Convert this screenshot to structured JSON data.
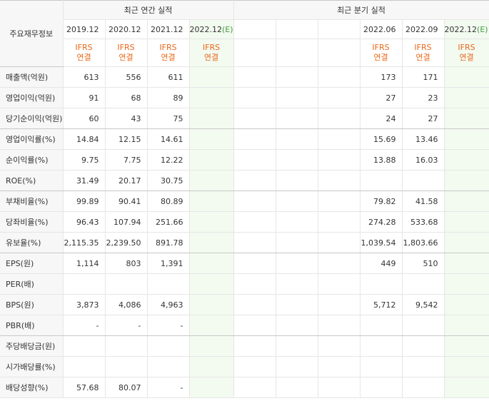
{
  "header": {
    "row_label": "주요재무정보",
    "annual_group": "최근 연간 실적",
    "quarter_group": "최근 분기 실적"
  },
  "annual_periods": [
    {
      "label": "2019.12",
      "estimate_mark": ""
    },
    {
      "label": "2020.12",
      "estimate_mark": ""
    },
    {
      "label": "2021.12",
      "estimate_mark": ""
    },
    {
      "label": "2022.12",
      "estimate_mark": "(E)"
    }
  ],
  "quarter_periods": [
    {
      "label": "",
      "estimate_mark": ""
    },
    {
      "label": "",
      "estimate_mark": ""
    },
    {
      "label": "",
      "estimate_mark": ""
    },
    {
      "label": "2022.06",
      "estimate_mark": ""
    },
    {
      "label": "2022.09",
      "estimate_mark": ""
    },
    {
      "label": "2022.12",
      "estimate_mark": "(E)"
    }
  ],
  "basis": {
    "line1": "IFRS",
    "line2": "연결"
  },
  "rows": [
    {
      "label": "매출액(억원)",
      "annual": [
        "613",
        "556",
        "611",
        ""
      ],
      "quarter": [
        "",
        "",
        "",
        "173",
        "171",
        ""
      ]
    },
    {
      "label": "영업이익(억원)",
      "annual": [
        "91",
        "68",
        "89",
        ""
      ],
      "quarter": [
        "",
        "",
        "",
        "27",
        "23",
        ""
      ]
    },
    {
      "label": "당기순이익(억원)",
      "annual": [
        "60",
        "43",
        "75",
        ""
      ],
      "quarter": [
        "",
        "",
        "",
        "24",
        "27",
        ""
      ]
    },
    {
      "label": "영업이익률(%)",
      "annual": [
        "14.84",
        "12.15",
        "14.61",
        ""
      ],
      "quarter": [
        "",
        "",
        "",
        "15.69",
        "13.46",
        ""
      ]
    },
    {
      "label": "순이익률(%)",
      "annual": [
        "9.75",
        "7.75",
        "12.22",
        ""
      ],
      "quarter": [
        "",
        "",
        "",
        "13.88",
        "16.03",
        ""
      ]
    },
    {
      "label": "ROE(%)",
      "annual": [
        "31.49",
        "20.17",
        "30.75",
        ""
      ],
      "quarter": [
        "",
        "",
        "",
        "",
        "",
        ""
      ]
    },
    {
      "label": "부채비율(%)",
      "annual": [
        "99.89",
        "90.41",
        "80.89",
        ""
      ],
      "quarter": [
        "",
        "",
        "",
        "79.82",
        "41.58",
        ""
      ]
    },
    {
      "label": "당좌비율(%)",
      "annual": [
        "96.43",
        "107.94",
        "251.66",
        ""
      ],
      "quarter": [
        "",
        "",
        "",
        "274.28",
        "533.68",
        ""
      ]
    },
    {
      "label": "유보율(%)",
      "annual": [
        "2,115.35",
        "2,239.50",
        "891.78",
        ""
      ],
      "quarter": [
        "",
        "",
        "",
        "1,039.54",
        "1,803.66",
        ""
      ]
    },
    {
      "label": "EPS(원)",
      "annual": [
        "1,114",
        "803",
        "1,391",
        ""
      ],
      "quarter": [
        "",
        "",
        "",
        "449",
        "510",
        ""
      ]
    },
    {
      "label": "PER(배)",
      "annual": [
        "",
        "",
        "",
        ""
      ],
      "quarter": [
        "",
        "",
        "",
        "",
        "",
        ""
      ]
    },
    {
      "label": "BPS(원)",
      "annual": [
        "3,873",
        "4,086",
        "4,963",
        ""
      ],
      "quarter": [
        "",
        "",
        "",
        "5,712",
        "9,542",
        ""
      ]
    },
    {
      "label": "PBR(배)",
      "annual": [
        "-",
        "-",
        "-",
        ""
      ],
      "quarter": [
        "",
        "",
        "",
        "",
        "",
        ""
      ]
    },
    {
      "label": "주당배당금(원)",
      "annual": [
        "",
        "",
        "",
        ""
      ],
      "quarter": [
        "",
        "",
        "",
        "",
        "",
        ""
      ]
    },
    {
      "label": "시가배당률(%)",
      "annual": [
        "",
        "",
        "",
        ""
      ],
      "quarter": [
        "",
        "",
        "",
        "",
        "",
        ""
      ]
    },
    {
      "label": "배당성향(%)",
      "annual": [
        "57.68",
        "80.07",
        "-",
        ""
      ],
      "quarter": [
        "",
        "",
        "",
        "",
        "",
        ""
      ]
    }
  ],
  "colors": {
    "estimate_bg": "#f3faf0",
    "ifrs_text": "#e8681a",
    "estimate_mark": "#3f9e3f"
  }
}
